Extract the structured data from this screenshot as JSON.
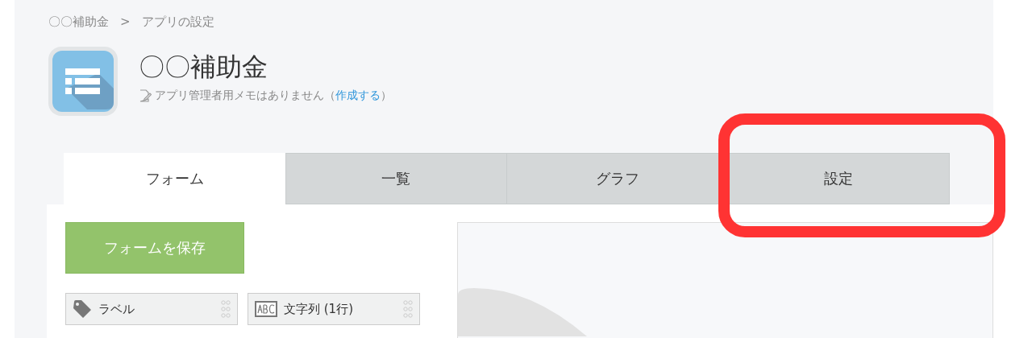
{
  "breadcrumb": [
    {
      "label": "〇〇補助金"
    },
    {
      "label": "アプリの設定"
    }
  ],
  "breadcrumb_separator": ">",
  "app": {
    "title": "〇〇補助金",
    "memo": "アプリ管理者用メモはありません",
    "memo_open": "（",
    "memo_link": "作成する",
    "memo_close": "）"
  },
  "tabs": [
    {
      "label": "フォーム",
      "selected": true
    },
    {
      "label": "一覧",
      "selected": false
    },
    {
      "label": "グラフ",
      "selected": false
    },
    {
      "label": "設定",
      "selected": false
    }
  ],
  "save_button": "フォームを保存",
  "fields": [
    {
      "label": "ラベル",
      "kind": "label"
    },
    {
      "label": "文字列 (1行)",
      "kind": "text"
    }
  ]
}
